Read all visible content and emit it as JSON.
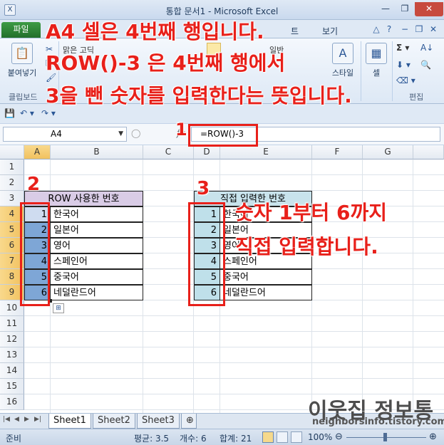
{
  "window": {
    "title": "통합 문서1 - Microsoft Excel",
    "min_label": "—",
    "max_label": "❐",
    "close_label": "✕"
  },
  "qat_icons": [
    "save-icon",
    "undo-icon",
    "redo-icon"
  ],
  "ribbon": {
    "file_tab": "파일",
    "tabs": [
      "보기"
    ],
    "clipboard": {
      "paste_label": "붙여넣기",
      "group_label": "클립보드"
    },
    "font": {
      "font_name": "맑은 고딕"
    },
    "number": {
      "format": "일반"
    },
    "style": {
      "label": "스타일"
    },
    "cells": {
      "label": "셀"
    },
    "editing": {
      "group_label": "편집"
    }
  },
  "formula_bar": {
    "name_box": "A4",
    "fx": "fx",
    "formula": "=ROW()-3"
  },
  "columns": [
    "A",
    "B",
    "C",
    "D",
    "E",
    "F",
    "G"
  ],
  "rows": [
    "1",
    "2",
    "3",
    "4",
    "5",
    "6",
    "7",
    "8",
    "9",
    "10",
    "11",
    "12",
    "13",
    "14",
    "15",
    "16"
  ],
  "sheet": {
    "b3": "ROW 사용한 번호",
    "e3": "직접 입력한 번호",
    "left_numbers": [
      "1",
      "2",
      "3",
      "4",
      "5",
      "6"
    ],
    "right_numbers": [
      "1",
      "2",
      "3",
      "4",
      "5",
      "6"
    ],
    "languages": [
      "한국어",
      "일본어",
      "영어",
      "스페인어",
      "중국어",
      "네덜란드어"
    ]
  },
  "sheet_tabs": [
    "Sheet1",
    "Sheet2",
    "Sheet3"
  ],
  "status": {
    "ready": "준비",
    "average": "평균: 3.5",
    "count": "개수: 6",
    "sum": "합계: 21",
    "zoom": "100%"
  },
  "annotations": {
    "line1": "A4 셀은 4번째 행입니다.",
    "line2": "ROW()-3 은 4번째 행에서",
    "line3": "3을 뺀 숫자를 입력한다는 뜻입니다.",
    "num1": "1",
    "num2": "2",
    "num3": "3",
    "right1": "숫자 1부터 6까지",
    "right2": "직접 입력합니다."
  },
  "watermark": {
    "title": "이웃집 정보통",
    "url": "neighborsinfo.tistory.com"
  },
  "colors": {
    "annotation_red": "#e8201a",
    "header_purple": "#d9cce6",
    "header_teal": "#c8e3ec",
    "selected_blue": "#7ea6d6",
    "teal_cell": "#bfe0ea"
  }
}
